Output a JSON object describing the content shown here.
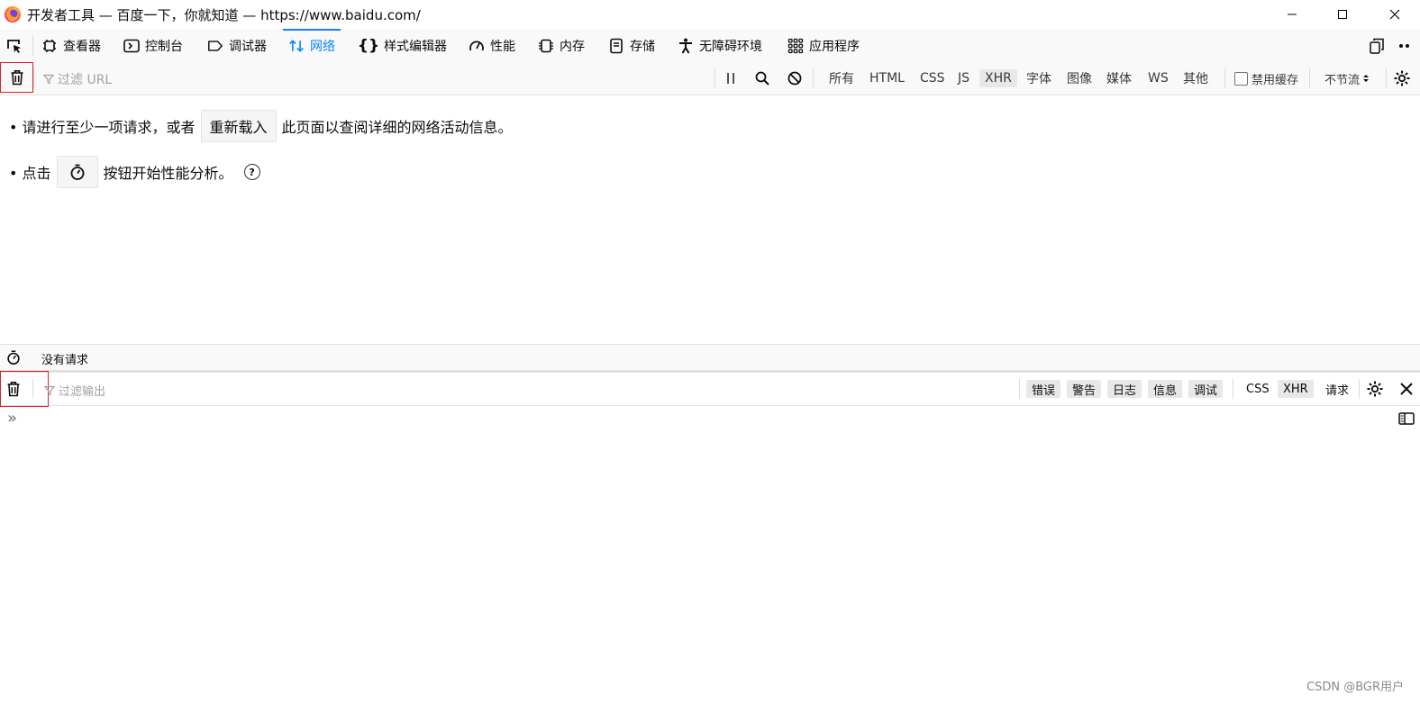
{
  "window": {
    "title": "开发者工具 — 百度一下，你就知道 — https://www.baidu.com/",
    "logo_icon": "firefox-logo"
  },
  "devtools_tabs": [
    {
      "label": "查看器",
      "icon": "inspector-icon"
    },
    {
      "label": "控制台",
      "icon": "console-icon"
    },
    {
      "label": "调试器",
      "icon": "debugger-icon"
    },
    {
      "label": "网络",
      "icon": "network-icon",
      "selected": true
    },
    {
      "label": "样式编辑器",
      "icon": "braces-icon"
    },
    {
      "label": "性能",
      "icon": "performance-icon"
    },
    {
      "label": "内存",
      "icon": "memory-icon"
    },
    {
      "label": "存储",
      "icon": "storage-icon"
    },
    {
      "label": "无障碍环境",
      "icon": "accessibility-icon"
    },
    {
      "label": "应用程序",
      "icon": "application-icon"
    }
  ],
  "network_toolbar": {
    "filter_placeholder": "过滤 URL",
    "type_filters": [
      "所有",
      "HTML",
      "CSS",
      "JS",
      "XHR",
      "字体",
      "图像",
      "媒体",
      "WS",
      "其他"
    ],
    "checked_filter": "XHR",
    "disable_cache_label": "禁用缓存",
    "throttling_label": "不节流"
  },
  "empty_notice": {
    "line1_before": "• 请进行至少一项请求，或者",
    "reload_button": "重新载入",
    "line1_after": "此页面以查阅详细的网络活动信息。",
    "line2_before": "• 点击",
    "line2_after": "按钮开始性能分析。"
  },
  "status": {
    "text": "没有请求"
  },
  "console_toolbar": {
    "filter_placeholder": "过滤输出",
    "level_filters": [
      "错误",
      "警告",
      "日志",
      "信息",
      "调试"
    ],
    "extra_filters": [
      {
        "label": "CSS",
        "checked": false
      },
      {
        "label": "XHR",
        "checked": true
      },
      {
        "label": "请求",
        "checked": false
      }
    ]
  },
  "console_prompt": "»",
  "watermark": "CSDN @BGR用户",
  "colors": {
    "accent": "#0a84ff",
    "highlight_box": "#e02020",
    "toolbar_bg": "#f9f9fa"
  }
}
